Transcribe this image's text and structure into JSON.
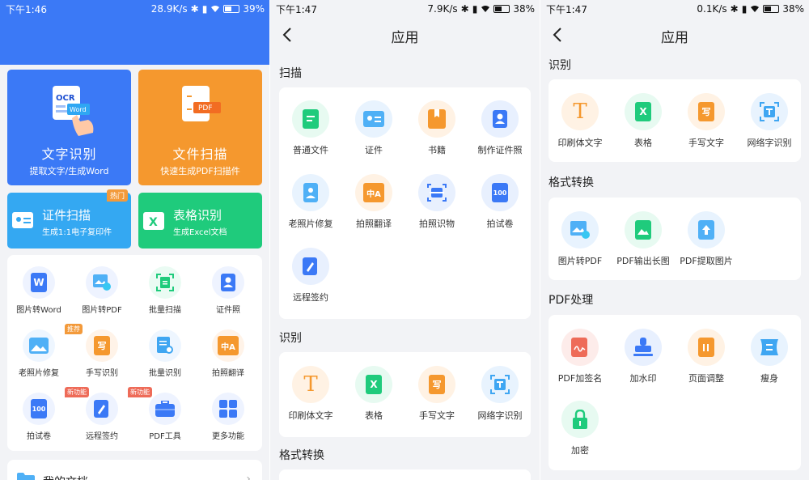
{
  "screen1": {
    "status": {
      "time": "下午1:46",
      "speed": "28.9K/s",
      "battery": "39%"
    },
    "cards": {
      "ocr": {
        "badge1": "OCR",
        "badge2": "Word",
        "title": "文字识别",
        "subtitle": "提取文字/生成Word"
      },
      "scan": {
        "badge": "PDF",
        "title": "文件扫描",
        "subtitle": "快速生成PDF扫描件"
      },
      "id_scan": {
        "title": "证件扫描",
        "subtitle": "生成1:1电子复印件",
        "hot": "热门"
      },
      "table": {
        "title": "表格识别",
        "subtitle": "生成Excel文档"
      }
    },
    "grid": [
      {
        "label": "图片转Word",
        "glyph": "W",
        "tag": ""
      },
      {
        "label": "图片转PDF",
        "glyph": "",
        "tag": ""
      },
      {
        "label": "批量扫描",
        "glyph": "",
        "tag": ""
      },
      {
        "label": "证件照",
        "glyph": "",
        "tag": ""
      },
      {
        "label": "老照片修复",
        "glyph": "",
        "tag": "推荐"
      },
      {
        "label": "手写识别",
        "glyph": "写",
        "tag": ""
      },
      {
        "label": "批量识别",
        "glyph": "",
        "tag": ""
      },
      {
        "label": "拍照翻译",
        "glyph": "中A",
        "tag": ""
      },
      {
        "label": "拍试卷",
        "glyph": "100",
        "tag": "新功能"
      },
      {
        "label": "远程签约",
        "glyph": "",
        "tag": "新功能"
      },
      {
        "label": "PDF工具",
        "glyph": "",
        "tag": ""
      },
      {
        "label": "更多功能",
        "glyph": "",
        "tag": ""
      }
    ],
    "my_docs": "我的文档"
  },
  "screen2": {
    "status": {
      "time": "下午1:47",
      "speed": "7.9K/s",
      "battery": "38%"
    },
    "title": "应用",
    "sections": {
      "scan": {
        "heading": "扫描",
        "items": [
          "普通文件",
          "证件",
          "书籍",
          "制作证件照",
          "老照片修复",
          "拍照翻译",
          "拍照识物",
          "拍试卷",
          "远程签约"
        ]
      },
      "recognize": {
        "heading": "识别",
        "items": [
          "印刷体文字",
          "表格",
          "手写文字",
          "网络字识别"
        ]
      },
      "convert": {
        "heading": "格式转换"
      }
    }
  },
  "screen3": {
    "status": {
      "time": "下午1:47",
      "speed": "0.1K/s",
      "battery": "38%"
    },
    "title": "应用",
    "sections": {
      "recognize": {
        "heading": "识别",
        "items": [
          "印刷体文字",
          "表格",
          "手写文字",
          "网络字识别"
        ]
      },
      "convert": {
        "heading": "格式转换",
        "items": [
          "图片转PDF",
          "PDF输出长图",
          "PDF提取图片"
        ]
      },
      "pdf": {
        "heading": "PDF处理",
        "items": [
          "PDF加签名",
          "加水印",
          "页面调整",
          "瘦身",
          "加密"
        ]
      }
    }
  },
  "glyphs": {
    "T": "T",
    "X": "X",
    "xie": "写",
    "zhongA": "中A",
    "score": "100"
  },
  "colors": {
    "brand_blue": "#3b79f6",
    "ocr_card": "#3b79f6",
    "scan_card": "#f5982e",
    "id_card": "#34a8f2",
    "table_card": "#1fcb7c"
  }
}
